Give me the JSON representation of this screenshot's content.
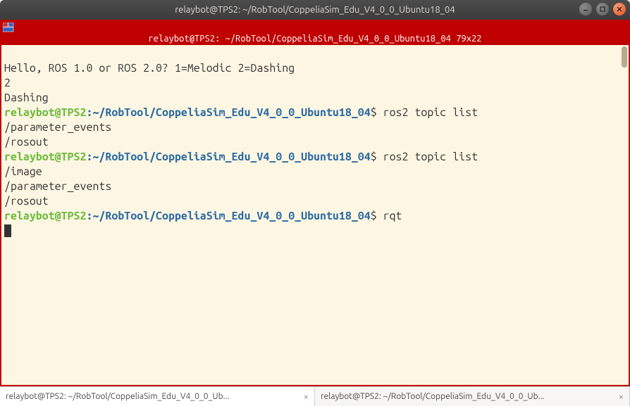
{
  "window": {
    "title": "relaybot@TPS2: ~/RobTool/CoppeliaSim_Edu_V4_0_0_Ubuntu18_04"
  },
  "term_tab_title": "relaybot@TPS2: ~/RobTool/CoppeliaSim_Edu_V4_0_0_Ubuntu18_04 79x22",
  "prompt": {
    "user_host": "relaybot@TPS2",
    "colon": ":",
    "path": "~/RobTool/CoppeliaSim_Edu_V4_0_0_Ubuntu18_04",
    "dollar": "$"
  },
  "lines": {
    "l1": "Hello, ROS 1.0 or ROS 2.0? 1=Melodic 2=Dashing",
    "l2": "2",
    "l3": "Dashing",
    "cmd1": " ros2 topic list",
    "l5": "/parameter_events",
    "l6": "/rosout",
    "cmd2": " ros2 topic list",
    "l8": "/image",
    "l9": "/parameter_events",
    "l10": "/rosout",
    "cmd3": " rqt"
  },
  "tabs": {
    "tab1": "relaybot@TPS2: ~/RobTool/CoppeliaSim_Edu_V4_0_0_Ub...",
    "tab2": "relaybot@TPS2: ~/RobTool/CoppeliaSim_Edu_V4_0_0_Ub...",
    "close": "×"
  }
}
